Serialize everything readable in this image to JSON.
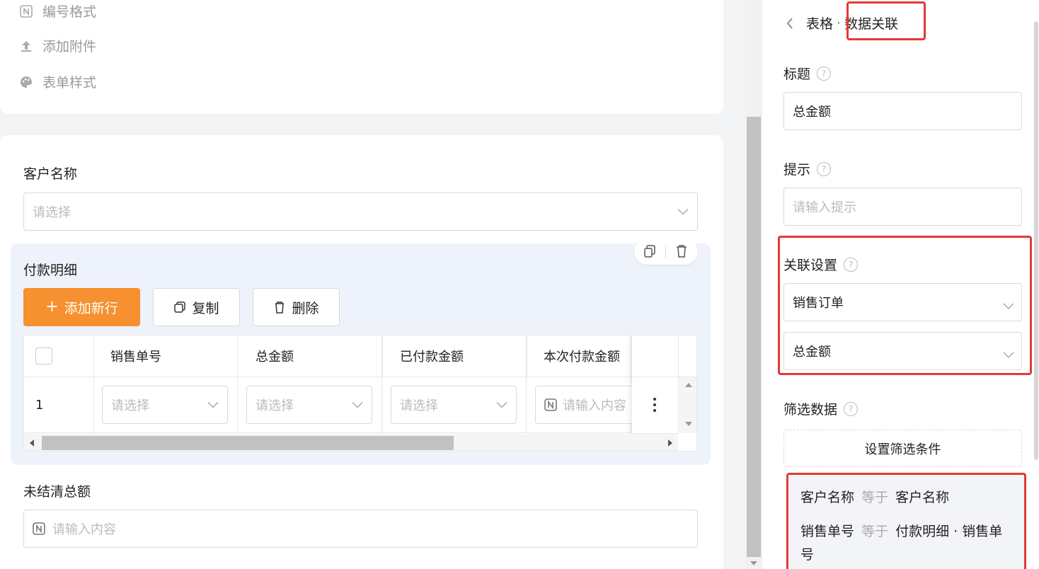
{
  "left_menu": {
    "items": [
      {
        "label": "编号格式",
        "icon": "number-format-icon"
      },
      {
        "label": "添加附件",
        "icon": "upload-icon"
      },
      {
        "label": "表单样式",
        "icon": "palette-icon"
      }
    ]
  },
  "form": {
    "customer": {
      "label": "客户名称",
      "placeholder": "请选择"
    },
    "payment_detail": {
      "title": "付款明细",
      "add_row_label": "添加新行",
      "copy_label": "复制",
      "delete_label": "删除",
      "columns": [
        "销售单号",
        "总金额",
        "已付款金额",
        "本次付款金额"
      ],
      "rows": [
        {
          "index": "1",
          "sales_no": "请选择",
          "total": "请选择",
          "paid": "请选择",
          "current": "请输入内容"
        }
      ]
    },
    "outstanding": {
      "label": "未结清总额",
      "placeholder": "请输入内容"
    }
  },
  "right_panel": {
    "breadcrumb_parent": "表格",
    "breadcrumb_sep": "·",
    "breadcrumb_current": "数据关联",
    "title_label": "标题",
    "title_value": "总金额",
    "hint_label": "提示",
    "hint_placeholder": "请输入提示",
    "relation_label": "关联设置",
    "relation_form": "销售订单",
    "relation_field": "总金额",
    "filter_label": "筛选数据",
    "filter_button": "设置筛选条件",
    "conditions": [
      {
        "field": "客户名称",
        "op": "等于",
        "value": "客户名称"
      },
      {
        "field": "销售单号",
        "op": "等于",
        "value": "付款明细 · 销售单号"
      }
    ]
  },
  "colors": {
    "accent": "#f7902f",
    "highlight_red": "#e53935",
    "subtable_bg": "#eef2fb"
  }
}
